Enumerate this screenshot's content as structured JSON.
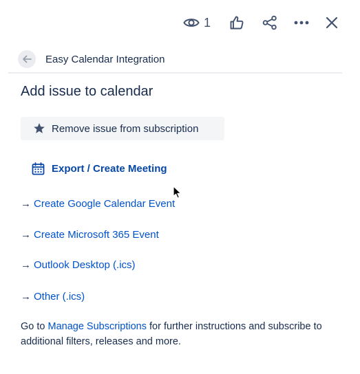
{
  "toolbar": {
    "watch_count": "1",
    "icons": [
      "eye-icon",
      "thumbs-up-icon",
      "share-icon",
      "more-icon",
      "close-icon"
    ]
  },
  "app": {
    "title": "Easy Calendar Integration"
  },
  "page": {
    "title": "Add issue to calendar"
  },
  "actions": {
    "remove_subscription": "Remove issue from subscription",
    "export_meeting": "Export / Create Meeting"
  },
  "options": [
    {
      "arrow": "→",
      "label": "Create Google Calendar Event"
    },
    {
      "arrow": "→",
      "label": "Create Microsoft 365 Event"
    },
    {
      "arrow": "→",
      "label": "Outlook Desktop (.ics)"
    },
    {
      "arrow": "→",
      "label": "Other (.ics)"
    }
  ],
  "note": {
    "prefix": "Go to ",
    "link": "Manage Subscriptions",
    "suffix": " for further instructions and subscribe to additional filters, releases and more."
  },
  "colors": {
    "link": "#0052cc",
    "export": "#0747a6",
    "text": "#172b4d",
    "icon": "#42526e",
    "button_bg": "#f4f5f7"
  }
}
